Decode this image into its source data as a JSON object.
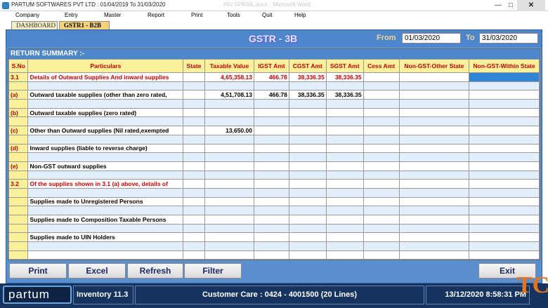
{
  "window": {
    "title": "PARTUM SOFTWARES PVT LTD : 01/04/2019 To 31/03/2020",
    "ghost_title": "INV-SPRAIL.docx - Microsoft Word",
    "min_glyph": "—",
    "max_glyph": "□",
    "close_glyph": "✕"
  },
  "menu": [
    {
      "label": "Company"
    },
    {
      "label": "Entry"
    },
    {
      "label": "Master"
    },
    {
      "label": "Report"
    },
    {
      "label": "Print"
    },
    {
      "label": "Tools"
    },
    {
      "label": "Quit"
    },
    {
      "label": "Help"
    }
  ],
  "tabs": [
    {
      "label": "DASHBOARD"
    },
    {
      "label": "GSTR1 - B2B"
    }
  ],
  "form": {
    "heading": "GSTR - 3B",
    "from_label": "From",
    "from_value": "01/03/2020",
    "to_label": "To",
    "to_value": "31/03/2020",
    "section_title": "RETURN SUMMARY :-"
  },
  "columns": [
    "S.No",
    "Particulars",
    "State",
    "Taxable Value",
    "IGST Amt",
    "CGST Amt",
    "SGST Amt",
    "Cess Amt",
    "Non-GST-Other State",
    "Non-GST-Within State"
  ],
  "rows": [
    {
      "sno": "3.1",
      "particulars": "Details of Outward Supplies And inward supplies",
      "state": "",
      "taxable": "4,65,358.13",
      "igst": "466.78",
      "cgst": "38,336.35",
      "sgst": "38,336.35",
      "cess": "",
      "ngos": "",
      "ngws": ""
    },
    {
      "sno": "",
      "particulars": "",
      "state": "",
      "taxable": "",
      "igst": "",
      "cgst": "",
      "sgst": "",
      "cess": "",
      "ngos": "",
      "ngws": ""
    },
    {
      "sno": "(a)",
      "particulars": "Outward taxable supplies (other than zero rated,",
      "state": "",
      "taxable": "4,51,708.13",
      "igst": "466.78",
      "cgst": "38,336.35",
      "sgst": "38,336.35",
      "cess": "",
      "ngos": "",
      "ngws": ""
    },
    {
      "sno": "",
      "particulars": "",
      "state": "",
      "taxable": "",
      "igst": "",
      "cgst": "",
      "sgst": "",
      "cess": "",
      "ngos": "",
      "ngws": ""
    },
    {
      "sno": "(b)",
      "particulars": "Outward taxable supplies (zero rated)",
      "state": "",
      "taxable": "",
      "igst": "",
      "cgst": "",
      "sgst": "",
      "cess": "",
      "ngos": "",
      "ngws": ""
    },
    {
      "sno": "",
      "particulars": "",
      "state": "",
      "taxable": "",
      "igst": "",
      "cgst": "",
      "sgst": "",
      "cess": "",
      "ngos": "",
      "ngws": ""
    },
    {
      "sno": "(c)",
      "particulars": "Other than Outward supplies (Nil rated,exempted",
      "state": "",
      "taxable": "13,650.00",
      "igst": "",
      "cgst": "",
      "sgst": "",
      "cess": "",
      "ngos": "",
      "ngws": ""
    },
    {
      "sno": "",
      "particulars": "",
      "state": "",
      "taxable": "",
      "igst": "",
      "cgst": "",
      "sgst": "",
      "cess": "",
      "ngos": "",
      "ngws": ""
    },
    {
      "sno": "(d)",
      "particulars": "Inward supplies (liable to reverse charge)",
      "state": "",
      "taxable": "",
      "igst": "",
      "cgst": "",
      "sgst": "",
      "cess": "",
      "ngos": "",
      "ngws": ""
    },
    {
      "sno": "",
      "particulars": "",
      "state": "",
      "taxable": "",
      "igst": "",
      "cgst": "",
      "sgst": "",
      "cess": "",
      "ngos": "",
      "ngws": ""
    },
    {
      "sno": "(e)",
      "particulars": "Non-GST outward supplies",
      "state": "",
      "taxable": "",
      "igst": "",
      "cgst": "",
      "sgst": "",
      "cess": "",
      "ngos": "",
      "ngws": ""
    },
    {
      "sno": "",
      "particulars": "",
      "state": "",
      "taxable": "",
      "igst": "",
      "cgst": "",
      "sgst": "",
      "cess": "",
      "ngos": "",
      "ngws": ""
    },
    {
      "sno": "3.2",
      "particulars": "Of the supplies shown in 3.1 (a) above, details of",
      "state": "",
      "taxable": "",
      "igst": "",
      "cgst": "",
      "sgst": "",
      "cess": "",
      "ngos": "",
      "ngws": ""
    },
    {
      "sno": "",
      "particulars": "",
      "state": "",
      "taxable": "",
      "igst": "",
      "cgst": "",
      "sgst": "",
      "cess": "",
      "ngos": "",
      "ngws": ""
    },
    {
      "sno": "",
      "particulars": "Supplies made to Unregistered Persons",
      "state": "",
      "taxable": "",
      "igst": "",
      "cgst": "",
      "sgst": "",
      "cess": "",
      "ngos": "",
      "ngws": ""
    },
    {
      "sno": "",
      "particulars": "",
      "state": "",
      "taxable": "",
      "igst": "",
      "cgst": "",
      "sgst": "",
      "cess": "",
      "ngos": "",
      "ngws": ""
    },
    {
      "sno": "",
      "particulars": "Supplies made to Composition Taxable Persons",
      "state": "",
      "taxable": "",
      "igst": "",
      "cgst": "",
      "sgst": "",
      "cess": "",
      "ngos": "",
      "ngws": ""
    },
    {
      "sno": "",
      "particulars": "",
      "state": "",
      "taxable": "",
      "igst": "",
      "cgst": "",
      "sgst": "",
      "cess": "",
      "ngos": "",
      "ngws": ""
    },
    {
      "sno": "",
      "particulars": "Supplies made to UIN Holders",
      "state": "",
      "taxable": "",
      "igst": "",
      "cgst": "",
      "sgst": "",
      "cess": "",
      "ngos": "",
      "ngws": ""
    },
    {
      "sno": "",
      "particulars": "",
      "state": "",
      "taxable": "",
      "igst": "",
      "cgst": "",
      "sgst": "",
      "cess": "",
      "ngos": "",
      "ngws": ""
    },
    {
      "sno": "",
      "particulars": "",
      "state": "",
      "taxable": "",
      "igst": "",
      "cgst": "",
      "sgst": "",
      "cess": "",
      "ngos": "",
      "ngws": ""
    }
  ],
  "buttons": {
    "print": "Print",
    "excel": "Excel",
    "refresh": "Refresh",
    "filter": "Filter",
    "exit": "Exit"
  },
  "status": {
    "logo": "partum",
    "version": "Inventory 11.3",
    "customer_care": "Customer Care : 0424 - 4001500  (20 Lines)",
    "datetime": "13/12/2020 8:58:31 PM",
    "corner_mark": "TC"
  },
  "colors": {
    "panel": "#5a8fcf",
    "header_fill": "#fbf19a",
    "header_text": "#c00000",
    "selected_cell": "#2f86d6",
    "status_bar": "#17345e"
  }
}
